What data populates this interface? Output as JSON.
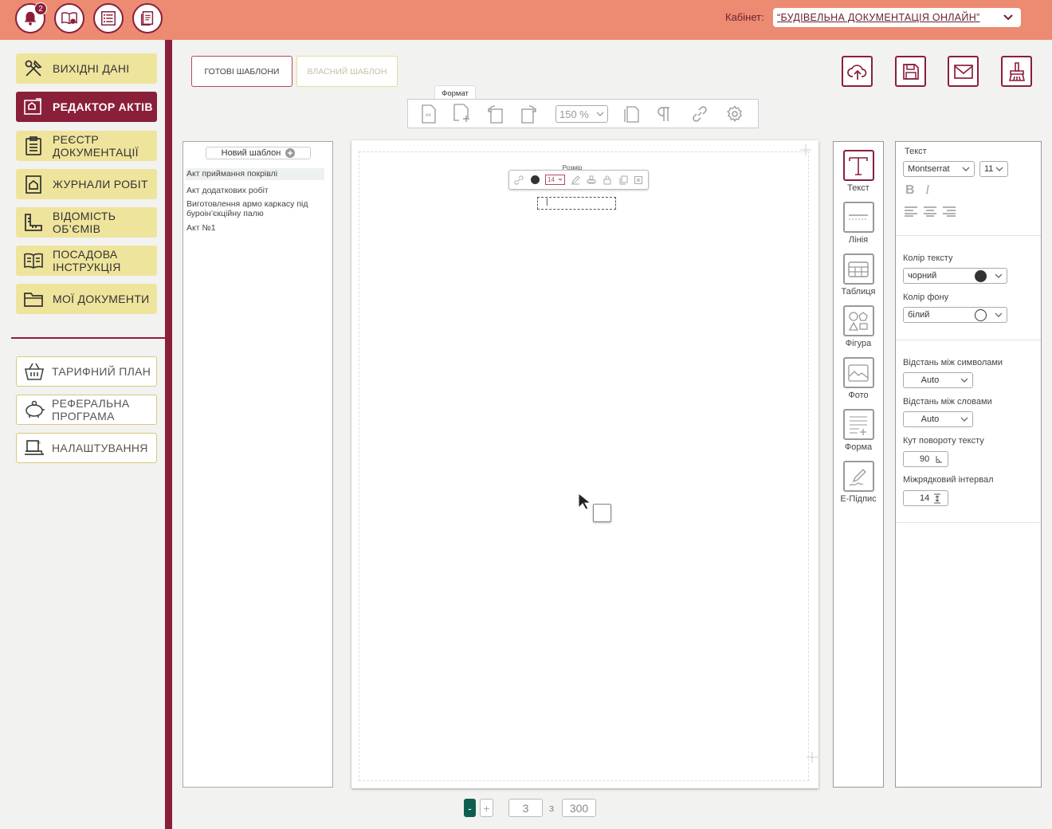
{
  "header": {
    "notifications_count": "2",
    "cabinet_label": "Кабінет:",
    "cabinet_value": "“БУДІВЕЛЬНА ДОКУМЕНТАЦІЯ ОНЛАЙН”"
  },
  "sidebar": {
    "items": [
      {
        "label": "Вихідні дані",
        "icon": "tools-icon"
      },
      {
        "label": "Редактор актів",
        "icon": "editor-icon"
      },
      {
        "label": "Реєстр документації",
        "icon": "clipboard-icon"
      },
      {
        "label": "Журнали робіт",
        "icon": "journal-icon"
      },
      {
        "label": "Відомість об’ємів",
        "icon": "ruler-icon"
      },
      {
        "label": "Посадова інструкція",
        "icon": "book-icon"
      },
      {
        "label": "Мої документи",
        "icon": "folder-icon"
      }
    ],
    "secondary": [
      {
        "label": "Тарифний план",
        "icon": "basket-icon"
      },
      {
        "label": "Реферальна програма",
        "icon": "piggy-bank-icon"
      },
      {
        "label": "Налаштування",
        "icon": "settings-laptop-icon"
      }
    ]
  },
  "tabs": {
    "ready": "Готові шаблони",
    "own": "Власний шаблон"
  },
  "toolbar": {
    "format_tooltip": "Формат",
    "page_format": "A4",
    "zoom": "150 %"
  },
  "templates": {
    "new_label": "Новий шаблон",
    "items": [
      "Акт приймання покрівлі",
      "Акт додаткових робіт",
      "Виготовлення армо каркасу під буроін’єкційну палю",
      "Акт №1"
    ]
  },
  "canvas": {
    "size_tooltip": "Розмір",
    "font_size": "14",
    "text_cursor": "|"
  },
  "pager": {
    "minus": "-",
    "plus": "+",
    "current": "3",
    "of": "з",
    "total": "300"
  },
  "tools": [
    {
      "label": "Текст",
      "icon": "text-tool-icon"
    },
    {
      "label": "Лінія",
      "icon": "line-tool-icon"
    },
    {
      "label": "Таблиця",
      "icon": "table-tool-icon"
    },
    {
      "label": "Фігура",
      "icon": "shapes-tool-icon"
    },
    {
      "label": "Фото",
      "icon": "photo-tool-icon"
    },
    {
      "label": "Форма",
      "icon": "form-tool-icon"
    },
    {
      "label": "Е-Підпис",
      "icon": "signature-tool-icon"
    }
  ],
  "props": {
    "text_label": "Текст",
    "font": "Montserrat",
    "font_size": "11",
    "bold": "B",
    "italic": "I",
    "text_color_label": "Колір тексту",
    "text_color": "чорний",
    "bg_color_label": "Колір фону",
    "bg_color": "білий",
    "char_spacing_label": "Відстань між символами",
    "char_spacing": "Auto",
    "word_spacing_label": "Відстань між словами",
    "word_spacing": "Auto",
    "rotation_label": "Кут повороту тексту",
    "rotation": "90",
    "line_spacing_label": "Міжрядковий інтервал",
    "line_spacing": "14"
  },
  "colors": {
    "header_bg": "#ec8a72",
    "brand": "#8a1f3a",
    "nav_bg": "#efe49c",
    "active_pager": "#0e5e4f"
  }
}
